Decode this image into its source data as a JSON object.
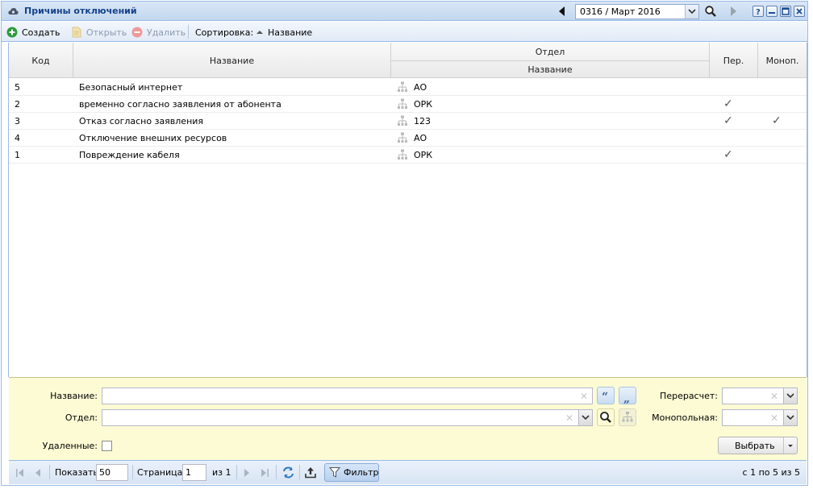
{
  "window": {
    "title": "Причины отключений",
    "period_value": "0316 / Март 2016"
  },
  "toolbar": {
    "create_label": "Создать",
    "open_label": "Открыть",
    "delete_label": "Удалить",
    "sort_label": "Сортировка:",
    "sort_field": "Название"
  },
  "grid": {
    "headers": {
      "code": "Код",
      "name": "Название",
      "dept_group": "Отдел",
      "dept_name": "Название",
      "per": "Пер.",
      "mono": "Моноп."
    },
    "rows": [
      {
        "code": "5",
        "name": "Безопасный интернет",
        "dept": "АО",
        "per": "",
        "mono": ""
      },
      {
        "code": "2",
        "name": "временно согласно заявления от абонента",
        "dept": "ОРК",
        "per": "✓",
        "mono": ""
      },
      {
        "code": "3",
        "name": "Отказ согласно заявления",
        "dept": "123",
        "per": "✓",
        "mono": "✓"
      },
      {
        "code": "4",
        "name": "Отключение внешних ресурсов",
        "dept": "АО",
        "per": "",
        "mono": ""
      },
      {
        "code": "1",
        "name": "Повреждение кабеля",
        "dept": "ОРК",
        "per": "✓",
        "mono": ""
      }
    ]
  },
  "filter": {
    "name_label": "Название:",
    "name_value": "",
    "dept_label": "Отдел:",
    "dept_value": "",
    "recalc_label": "Перерасчет:",
    "recalc_value": "",
    "mono_label": "Монопольная:",
    "mono_value": "",
    "deleted_label": "Удаленные:",
    "select_label": "Выбрать"
  },
  "pager": {
    "show_label": "Показать",
    "page_size": "50",
    "page_label": "Страница",
    "page_value": "1",
    "of_label": "из 1",
    "filter_label": "Фильтр",
    "summary": "с 1 по 5 из 5"
  },
  "colors": {
    "title_text": "#15428b",
    "filter_bg": "#fdfbd4",
    "create_icon": "#2e9a3a",
    "delete_icon": "#e06666"
  }
}
